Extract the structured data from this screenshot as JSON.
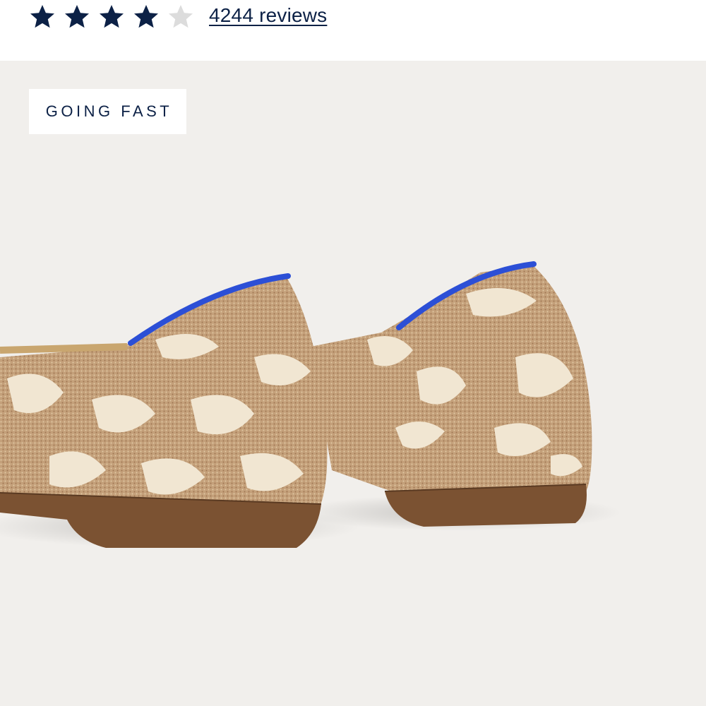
{
  "rating": {
    "stars_filled": 4,
    "stars_total": 5,
    "filled_color": "#0c2146",
    "empty_color": "#dcdcdc",
    "reviews_label": "4244 reviews"
  },
  "product_image": {
    "badge_label": "GOING FAST",
    "background_color": "#f1efec",
    "description_icon": "knit-flat-shoes-image"
  }
}
